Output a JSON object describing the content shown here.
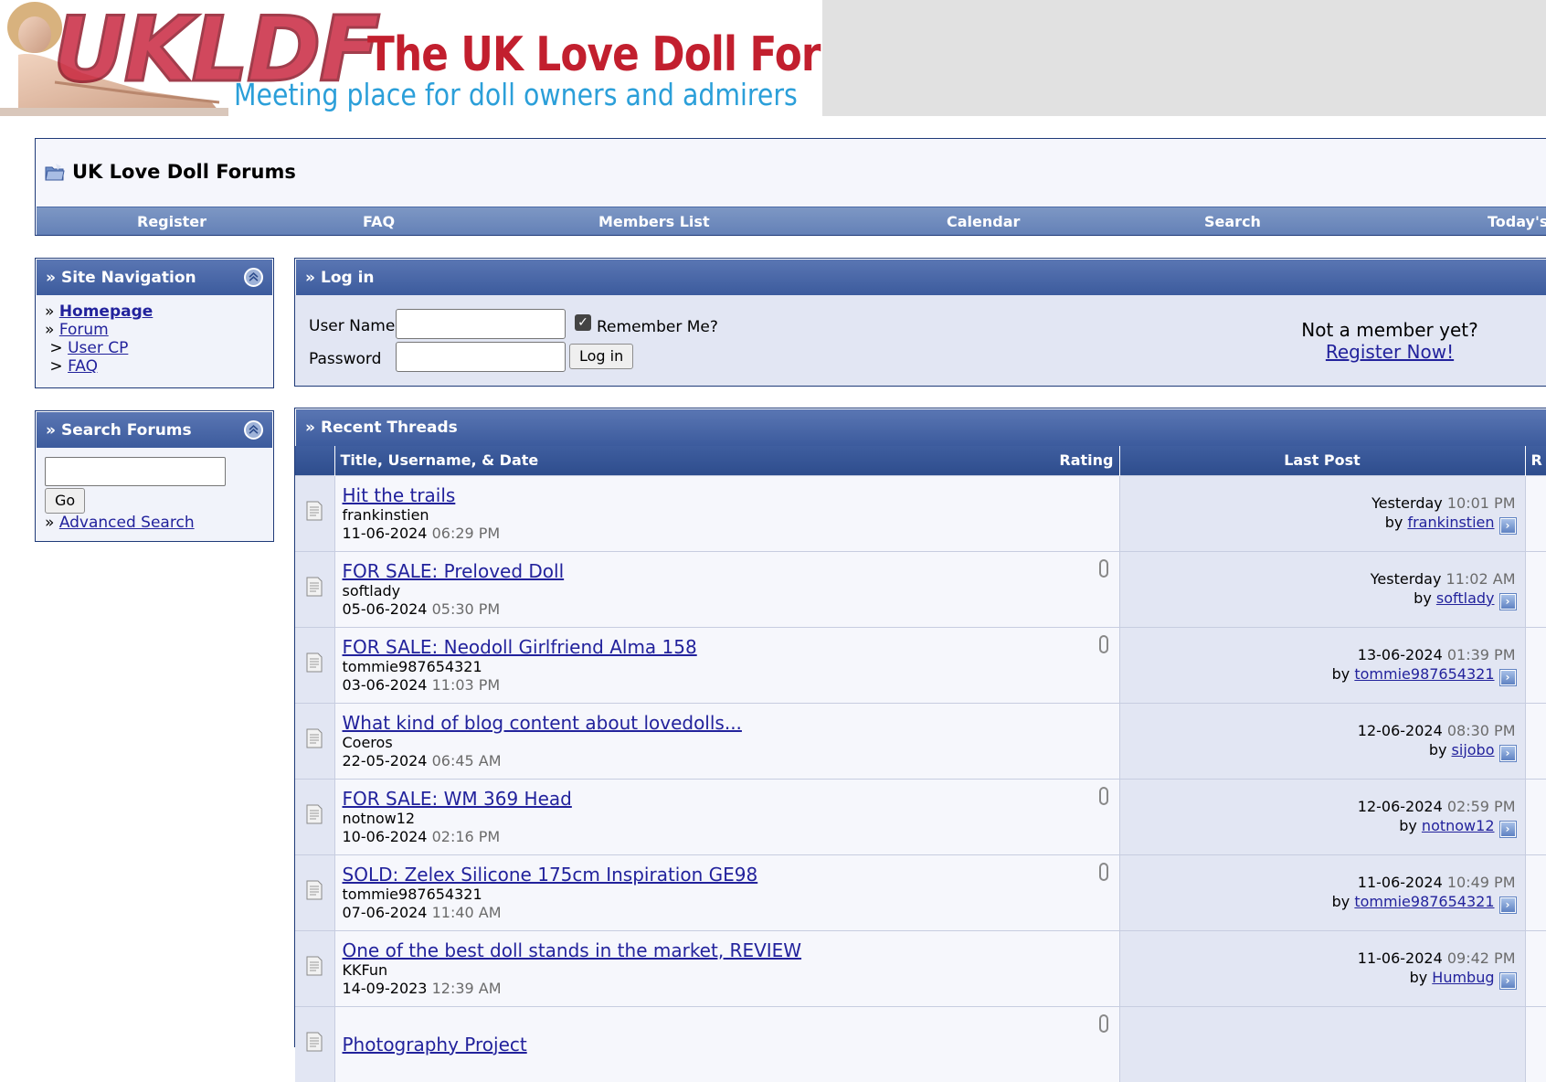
{
  "banner": {
    "logo_initials": "UKLDF",
    "logo_title": "The UK Love Doll Forum",
    "logo_tagline": "Meeting place for doll owners and admirers"
  },
  "header": {
    "forum_title": "UK Love Doll Forums",
    "nav": [
      "Register",
      "FAQ",
      "Members List",
      "Calendar",
      "Search",
      "Today's"
    ]
  },
  "site_nav": {
    "title": "Site Navigation",
    "homepage": "Homepage",
    "forum": "Forum",
    "user_cp": "User CP",
    "faq": "FAQ"
  },
  "search_box": {
    "title": "Search Forums",
    "go": "Go",
    "advanced": "Advanced Search"
  },
  "login": {
    "title": "Log in",
    "username_label": "User Name",
    "password_label": "Password",
    "remember": "Remember Me?",
    "remember_checked": true,
    "button": "Log in",
    "not_member": "Not a member yet?",
    "register_now": "Register Now!"
  },
  "recent": {
    "title": "Recent Threads",
    "col_title": "Title, Username, & Date",
    "col_rating": "Rating",
    "col_last": "Last Post",
    "col_extra": "R",
    "threads": [
      {
        "title": "Hit the trails",
        "user": "frankinstien",
        "date": "11-06-2024",
        "time": "06:29 PM",
        "attachment": false,
        "last_date": "Yesterday",
        "last_time": "10:01 PM",
        "last_by_prefix": "by",
        "last_by": "frankinstien"
      },
      {
        "title": "FOR SALE: Preloved Doll",
        "user": "softlady",
        "date": "05-06-2024",
        "time": "05:30 PM",
        "attachment": true,
        "last_date": "Yesterday",
        "last_time": "11:02 AM",
        "last_by_prefix": "by",
        "last_by": "softlady"
      },
      {
        "title": "FOR SALE: Neodoll Girlfriend Alma 158",
        "user": "tommie987654321",
        "date": "03-06-2024",
        "time": "11:03 PM",
        "attachment": true,
        "last_date": "13-06-2024",
        "last_time": "01:39 PM",
        "last_by_prefix": "by",
        "last_by": "tommie987654321"
      },
      {
        "title": "What kind of blog content about lovedolls...",
        "user": "Coeros",
        "date": "22-05-2024",
        "time": "06:45 AM",
        "attachment": false,
        "last_date": "12-06-2024",
        "last_time": "08:30 PM",
        "last_by_prefix": "by",
        "last_by": "sijobo"
      },
      {
        "title": "FOR SALE: WM 369 Head",
        "user": "notnow12",
        "date": "10-06-2024",
        "time": "02:16 PM",
        "attachment": true,
        "last_date": "12-06-2024",
        "last_time": "02:59 PM",
        "last_by_prefix": "by",
        "last_by": "notnow12"
      },
      {
        "title": "SOLD: Zelex Silicone 175cm Inspiration GE98",
        "user": "tommie987654321",
        "date": "07-06-2024",
        "time": "11:40 AM",
        "attachment": true,
        "last_date": "11-06-2024",
        "last_time": "10:49 PM",
        "last_by_prefix": "by",
        "last_by": "tommie987654321"
      },
      {
        "title": "One of the best doll stands in the market, REVIEW",
        "user": "KKFun",
        "date": "14-09-2023",
        "time": "12:39 AM",
        "attachment": false,
        "last_date": "11-06-2024",
        "last_time": "09:42 PM",
        "last_by_prefix": "by",
        "last_by": "Humbug"
      },
      {
        "title": "Photography Project",
        "user": "",
        "date": "",
        "time": "",
        "attachment": true,
        "last_date": "",
        "last_time": "",
        "last_by_prefix": "",
        "last_by": ""
      }
    ]
  }
}
